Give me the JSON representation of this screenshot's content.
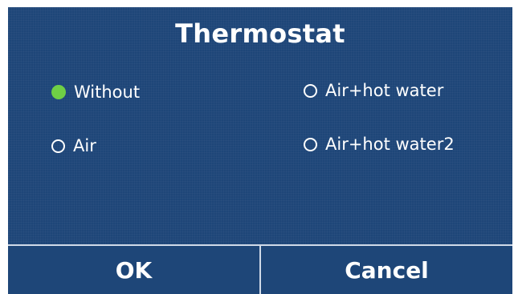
{
  "screen": {
    "title": "Thermostat",
    "background_color": "#1e4678",
    "accent_color": "#6fcf45"
  },
  "options": [
    {
      "label": "Without",
      "selected": true,
      "icon": "radio-checked-icon"
    },
    {
      "label": "Air",
      "selected": false,
      "icon": "radio-unchecked-icon"
    },
    {
      "label": "Air+hot water",
      "selected": false,
      "icon": "radio-unchecked-icon"
    },
    {
      "label": "Air+hot water2",
      "selected": false,
      "icon": "radio-unchecked-icon"
    }
  ],
  "footer": {
    "ok_label": "OK",
    "cancel_label": "Cancel"
  }
}
